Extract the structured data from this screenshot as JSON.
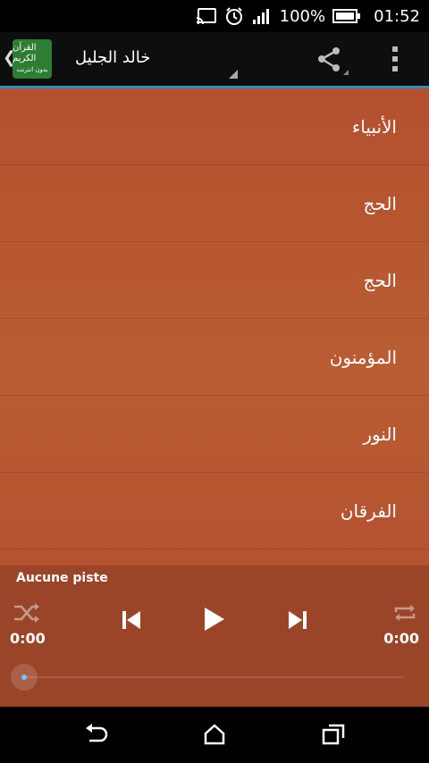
{
  "status": {
    "battery_percent": "100%",
    "time": "01:52"
  },
  "header": {
    "logo_text": "القرآن الكريم",
    "logo_sub": "بدون انترنت",
    "title": "خالد الجليل"
  },
  "list": {
    "items": [
      "الأنبياء",
      "الحج",
      "الحج",
      "المؤمنون",
      "النور",
      "الفرقان"
    ]
  },
  "player": {
    "track": "Aucune piste",
    "time_elapsed": "0:00",
    "time_total": "0:00",
    "progress": 0
  },
  "colors": {
    "accent_line": "#2f8fbf",
    "list_bg": "#b4502f",
    "player_bg": "#9b4528"
  }
}
